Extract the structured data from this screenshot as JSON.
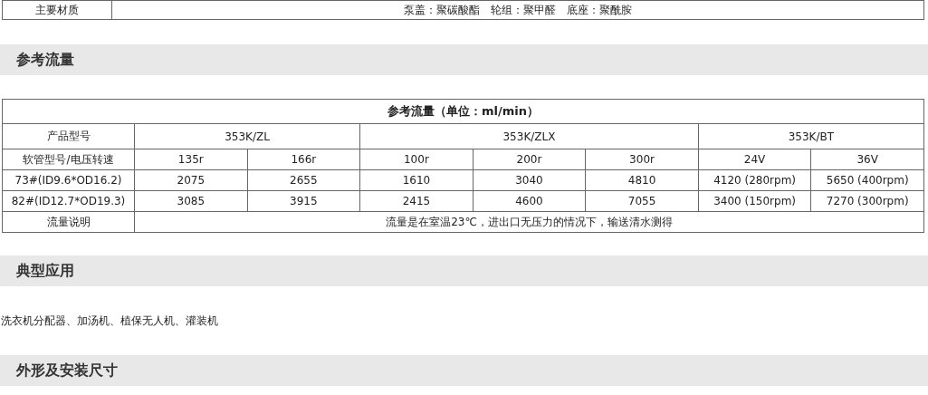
{
  "material": {
    "label": "主要材质",
    "value": "泵盖：聚碳酸酯　轮组：聚甲醛　底座：聚酰胺"
  },
  "flow_section": {
    "heading": "参考流量",
    "table": {
      "caption": "参考流量（单位：ml/min）",
      "model_label": "产品型号",
      "speed_label": "软管型号/电压转速",
      "models": [
        {
          "name": "353K/ZL",
          "speeds": [
            "135r",
            "166r"
          ]
        },
        {
          "name": "353K/ZLX",
          "speeds": [
            "100r",
            "200r",
            "300r"
          ]
        },
        {
          "name": "353K/BT",
          "speeds": [
            "24V",
            "36V"
          ]
        }
      ],
      "rows": [
        {
          "hose": "73#(ID9.6*OD16.2)",
          "values": [
            "2075",
            "2655",
            "1610",
            "3040",
            "4810",
            "4120 (280rpm)",
            "5650 (400rpm)"
          ]
        },
        {
          "hose": "82#(ID12.7*OD19.3)",
          "values": [
            "3085",
            "3915",
            "2415",
            "4600",
            "7055",
            "3400 (150rpm)",
            "7270 (300rpm)"
          ]
        }
      ],
      "note_label": "流量说明",
      "note": "流量是在室温23℃，进出口无压力的情况下，输送清水测得"
    }
  },
  "applications_section": {
    "heading": "典型应用",
    "text": "洗衣机分配器、加汤机、植保无人机、灌装机"
  },
  "dimensions_section": {
    "heading": "外形及安装尺寸"
  }
}
